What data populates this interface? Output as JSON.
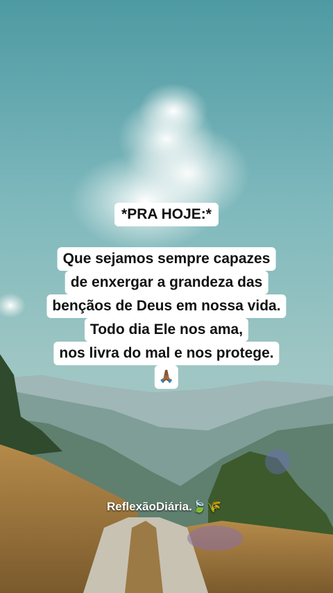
{
  "heading": "*PRA HOJE:*",
  "lines": [
    "Que sejamos sempre capazes",
    "de enxergar a grandeza das",
    "bençãos de Deus em nossa vida.",
    "Todo dia Ele nos ama,",
    "nos livra do mal e nos protege."
  ],
  "prayer_emoji": "🙏🏾",
  "caption": "ReflexãoDiária.",
  "caption_emoji": "🍃🌾"
}
